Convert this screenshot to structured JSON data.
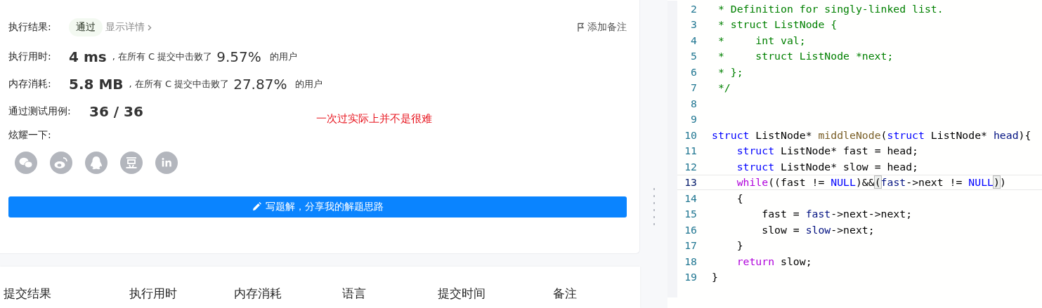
{
  "result": {
    "status_label": "执行结果:",
    "status": "通过",
    "details_link": "显示详情",
    "add_note": "添加备注",
    "stats": [
      {
        "label": "执行用时:",
        "value": "4 ms",
        "middle": ", 在所有 C 提交中击败了",
        "percent": "9.57%",
        "suffix": "的用户"
      },
      {
        "label": "内存消耗:",
        "value": "5.8 MB",
        "middle": ", 在所有 C 提交中击败了",
        "percent": "27.87%",
        "suffix": "的用户"
      }
    ],
    "tests_label": "通过测试用例:",
    "tests_value": "36 / 36",
    "share_label": "炫耀一下:",
    "share_icons": [
      {
        "kind": "wechat"
      },
      {
        "kind": "weibo"
      },
      {
        "kind": "qq"
      },
      {
        "kind": "douban"
      },
      {
        "kind": "linkedin"
      }
    ],
    "write_button": "写题解，分享我的解题思路",
    "annotation": "一次过实际上并不是很难"
  },
  "table": {
    "columns": [
      "提交结果",
      "执行用时",
      "内存消耗",
      "语言",
      "提交时间",
      "备注"
    ]
  },
  "editor": {
    "lines": [
      {
        "number": "2",
        "current": false,
        "tokens": [
          {
            "kind": "comment",
            "text": " * Definition for singly-linked list."
          }
        ]
      },
      {
        "number": "3",
        "current": false,
        "tokens": [
          {
            "kind": "comment",
            "text": " * struct ListNode {"
          }
        ]
      },
      {
        "number": "4",
        "current": false,
        "tokens": [
          {
            "kind": "comment",
            "text": " *     int val;"
          }
        ]
      },
      {
        "number": "5",
        "current": false,
        "tokens": [
          {
            "kind": "comment",
            "text": " *     struct ListNode *next;"
          }
        ]
      },
      {
        "number": "6",
        "current": false,
        "tokens": [
          {
            "kind": "comment",
            "text": " * };"
          }
        ]
      },
      {
        "number": "7",
        "current": false,
        "tokens": [
          {
            "kind": "comment",
            "text": " */"
          }
        ]
      },
      {
        "number": "8",
        "current": false
      },
      {
        "number": "9",
        "current": false
      },
      {
        "number": "10",
        "current": false,
        "tokens": [
          {
            "kind": "keyword",
            "text": "struct"
          },
          {
            "kind": "plain",
            "text": " ListNode* "
          },
          {
            "kind": "function",
            "text": "middleNode"
          },
          {
            "kind": "plain",
            "text": "("
          },
          {
            "kind": "keyword",
            "text": "struct"
          },
          {
            "kind": "plain",
            "text": " ListNode* "
          },
          {
            "kind": "variable",
            "text": "head"
          },
          {
            "kind": "plain",
            "text": "){"
          }
        ]
      },
      {
        "number": "11",
        "current": false,
        "tokens": [
          {
            "kind": "keyword",
            "text": "    struct"
          },
          {
            "kind": "plain",
            "text": " ListNode* fast = head;"
          }
        ]
      },
      {
        "number": "12",
        "current": false,
        "tokens": [
          {
            "kind": "keyword",
            "text": "    struct"
          },
          {
            "kind": "plain",
            "text": " ListNode* slow = head;"
          }
        ]
      },
      {
        "number": "13",
        "current": true,
        "tokens": [
          {
            "kind": "control",
            "text": "    while"
          },
          {
            "kind": "plain",
            "text": "((fast != "
          },
          {
            "kind": "constant",
            "text": "NULL"
          },
          {
            "kind": "plain",
            "text": ")&&"
          },
          {
            "kind": "match",
            "text": "("
          },
          {
            "kind": "variable",
            "text": "fast"
          },
          {
            "kind": "plain",
            "text": "->next != "
          },
          {
            "kind": "constant",
            "text": "NULL"
          },
          {
            "kind": "match",
            "text": ")"
          },
          {
            "kind": "plain",
            "text": ")"
          }
        ]
      },
      {
        "number": "14",
        "current": false,
        "tokens": [
          {
            "kind": "plain",
            "text": "    {"
          }
        ]
      },
      {
        "number": "15",
        "current": false,
        "tokens": [
          {
            "kind": "plain",
            "text": "        fast = "
          },
          {
            "kind": "variable",
            "text": "fast"
          },
          {
            "kind": "plain",
            "text": "->next->next;"
          }
        ]
      },
      {
        "number": "16",
        "current": false,
        "tokens": [
          {
            "kind": "plain",
            "text": "        slow = "
          },
          {
            "kind": "variable",
            "text": "slow"
          },
          {
            "kind": "plain",
            "text": "->next;"
          }
        ]
      },
      {
        "number": "17",
        "current": false,
        "tokens": [
          {
            "kind": "plain",
            "text": "    }"
          }
        ]
      },
      {
        "number": "18",
        "current": false,
        "tokens": [
          {
            "kind": "control",
            "text": "    return"
          },
          {
            "kind": "plain",
            "text": " slow;"
          }
        ]
      },
      {
        "number": "19",
        "current": false,
        "tokens": [
          {
            "kind": "plain",
            "text": "}"
          }
        ]
      }
    ]
  }
}
